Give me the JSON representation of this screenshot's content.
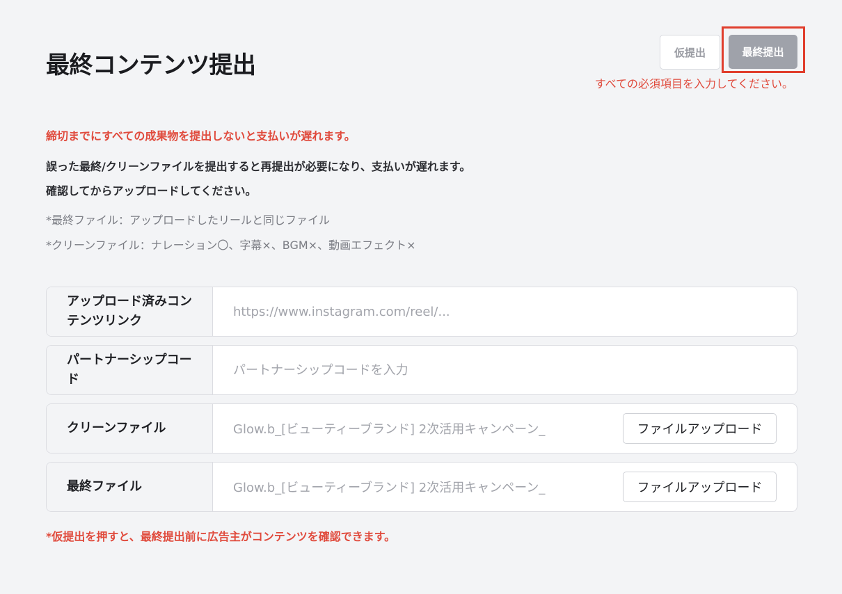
{
  "header": {
    "title": "最終コンテンツ提出",
    "draft_button": "仮提出",
    "final_button": "最終提出",
    "required_error": "すべての必須項目を入力してください。"
  },
  "notices": {
    "deadline": "締切までにすべての成果物を提出しないと支払いが遅れます。",
    "line1": "誤った最終/クリーンファイルを提出すると再提出が必要になり、支払いが遅れます。",
    "line2": "確認してからアップロードしてください。",
    "note_final": "*最終ファイル：アップロードしたリールと同じファイル",
    "note_clean": "*クリーンファイル：ナレーション〇、字幕×、BGM×、動画エフェクト×"
  },
  "form": {
    "link": {
      "label": "アップロード済みコンテンツリンク",
      "value": "",
      "placeholder": "https://www.instagram.com/reel/..."
    },
    "partnership": {
      "label": "パートナーシップコード",
      "value": "",
      "placeholder": "パートナーシップコードを入力"
    },
    "clean_file": {
      "label": "クリーンファイル",
      "file_name": "Glow.b_[ビューティーブランド] 2次活用キャンペーン_",
      "button": "ファイルアップロード"
    },
    "final_file": {
      "label": "最終ファイル",
      "file_name": "Glow.b_[ビューティーブランド] 2次活用キャンペーン_",
      "button": "ファイルアップロード"
    }
  },
  "footer": {
    "note": "*仮提出を押すと、最終提出前に広告主がコンテンツを確認できます。"
  },
  "colors": {
    "background": "#f3f4f6",
    "error": "#e04a3c",
    "highlight_frame": "#e03e2d",
    "final_button_bg": "#9fa2aa"
  }
}
